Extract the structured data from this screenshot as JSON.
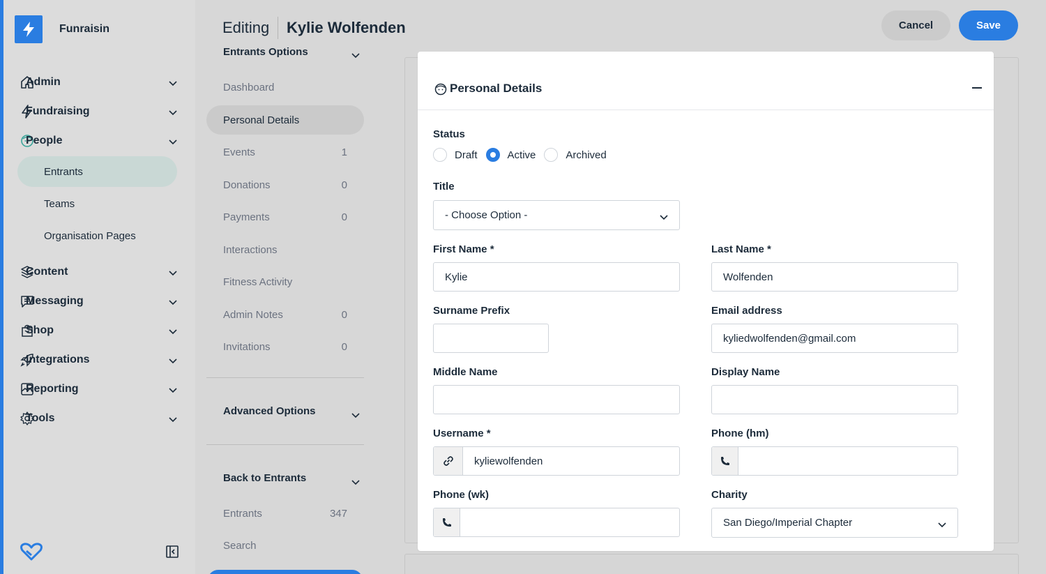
{
  "brand": {
    "name": "Funraisin"
  },
  "nav": {
    "items": [
      {
        "label": "Admin",
        "icon": "home-icon"
      },
      {
        "label": "Fundraising",
        "icon": "bolt-icon"
      },
      {
        "label": "People",
        "icon": "face-icon"
      },
      {
        "label": "Content",
        "icon": "layers-icon"
      },
      {
        "label": "Messaging",
        "icon": "message-icon"
      },
      {
        "label": "Shop",
        "icon": "bag-icon"
      },
      {
        "label": "Integrations",
        "icon": "rocket-icon"
      },
      {
        "label": "Reporting",
        "icon": "chart-icon"
      },
      {
        "label": "Tools",
        "icon": "gear-icon"
      }
    ],
    "people_sub": [
      "Entrants",
      "Teams",
      "Organisation Pages"
    ]
  },
  "header": {
    "editing": "Editing",
    "name": "Kylie Wolfenden",
    "cancel": "Cancel",
    "save": "Save"
  },
  "subnav": {
    "cut_title": "Entrants Options",
    "items": [
      {
        "label": "Dashboard",
        "count": ""
      },
      {
        "label": "Personal Details",
        "count": ""
      },
      {
        "label": "Events",
        "count": "1"
      },
      {
        "label": "Donations",
        "count": "0"
      },
      {
        "label": "Payments",
        "count": "0"
      },
      {
        "label": "Interactions",
        "count": ""
      },
      {
        "label": "Fitness Activity",
        "count": ""
      },
      {
        "label": "Admin Notes",
        "count": "0"
      },
      {
        "label": "Invitations",
        "count": "0"
      }
    ],
    "advanced": "Advanced Options",
    "back": "Back to Entrants",
    "back_items": [
      {
        "label": "Entrants",
        "count": "347"
      },
      {
        "label": "Search",
        "count": ""
      }
    ]
  },
  "card": {
    "title": "Personal Details",
    "status_label": "Status",
    "status_options": [
      "Draft",
      "Active",
      "Archived"
    ],
    "status_selected": "Active",
    "title_label": "Title",
    "title_value": "- Choose Option -",
    "first_name_label": "First Name *",
    "first_name": "Kylie",
    "last_name_label": "Last Name *",
    "last_name": "Wolfenden",
    "surname_prefix_label": "Surname Prefix",
    "surname_prefix": "",
    "email_label": "Email address",
    "email": "kyliedwolfenden@gmail.com",
    "middle_name_label": "Middle Name",
    "middle_name": "",
    "display_name_label": "Display Name",
    "display_name": "",
    "username_label": "Username *",
    "username": "kyliewolfenden",
    "phone_hm_label": "Phone (hm)",
    "phone_hm": "",
    "phone_wk_label": "Phone (wk)",
    "phone_wk": "",
    "charity_label": "Charity",
    "charity": "San Diego/Imperial Chapter"
  },
  "colors": {
    "accent": "#2a7de1",
    "active_nav": "#c9d8d5",
    "people_icon": "#3aa59a"
  }
}
